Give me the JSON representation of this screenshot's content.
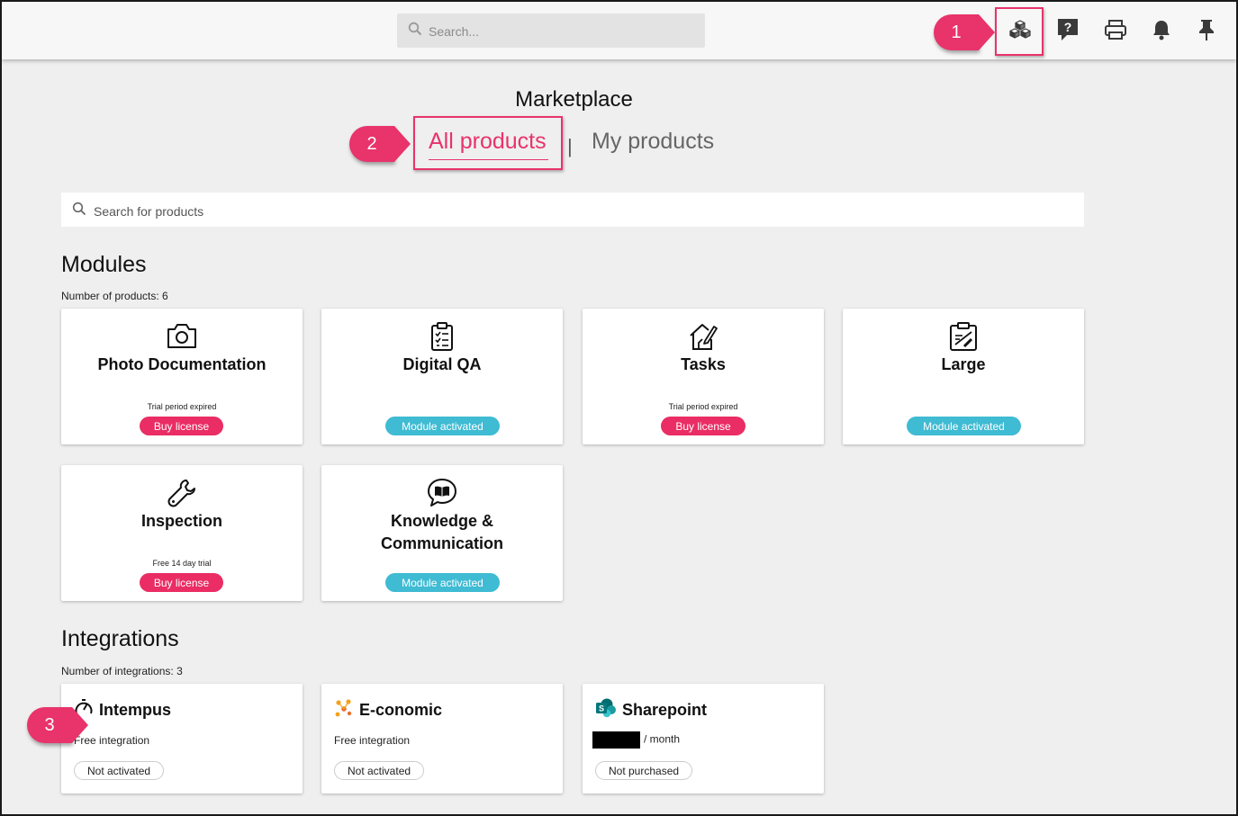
{
  "topbar": {
    "search_placeholder": "Search...",
    "icons": [
      "marketplace-cubes-icon",
      "help-icon",
      "print-icon",
      "notifications-bell-icon",
      "pin-icon"
    ]
  },
  "annotations": {
    "callout_1": "1",
    "callout_2": "2",
    "callout_3": "3",
    "accent_color": "#e8336b"
  },
  "page": {
    "title": "Marketplace",
    "tabs": [
      {
        "label": "All products",
        "active": true
      },
      {
        "label": "My products",
        "active": false
      }
    ],
    "tab_separator": "|",
    "search_placeholder": "Search for products"
  },
  "modules": {
    "title": "Modules",
    "count_label": "Number of products: 6",
    "items": [
      {
        "title": "Photo Documentation",
        "icon": "camera-icon",
        "note": "Trial period expired",
        "action": "Buy license"
      },
      {
        "title": "Digital QA",
        "icon": "clipboard-checklist-icon",
        "note": "",
        "action": "Module activated"
      },
      {
        "title": "Tasks",
        "icon": "house-pencil-icon",
        "note": "Trial period expired",
        "action": "Buy license"
      },
      {
        "title": "Large",
        "icon": "clipboard-blueprint-icon",
        "note": "",
        "action": "Module activated"
      },
      {
        "title": "Inspection",
        "icon": "wrench-icon",
        "note": "Free 14 day trial",
        "action": "Buy license"
      },
      {
        "title": "Knowledge & Communication",
        "icon": "speech-book-icon",
        "note": "",
        "action": "Module activated"
      }
    ]
  },
  "integrations": {
    "title": "Integrations",
    "count_label": "Number of integrations: 3",
    "items": [
      {
        "title": "Intempus",
        "icon": "stopwatch-icon",
        "sub": "Free integration",
        "status": "Not activated"
      },
      {
        "title": "E-conomic",
        "icon": "e-conomic-logo-icon",
        "sub": "Free integration",
        "status": "Not activated"
      },
      {
        "title": "Sharepoint",
        "icon": "sharepoint-logo-icon",
        "sub": "/ month",
        "status": "Not purchased"
      }
    ]
  },
  "colors": {
    "buy_license": "#ea2d64",
    "module_activated": "#3fbbd3",
    "active_tab": "#e8336b"
  }
}
